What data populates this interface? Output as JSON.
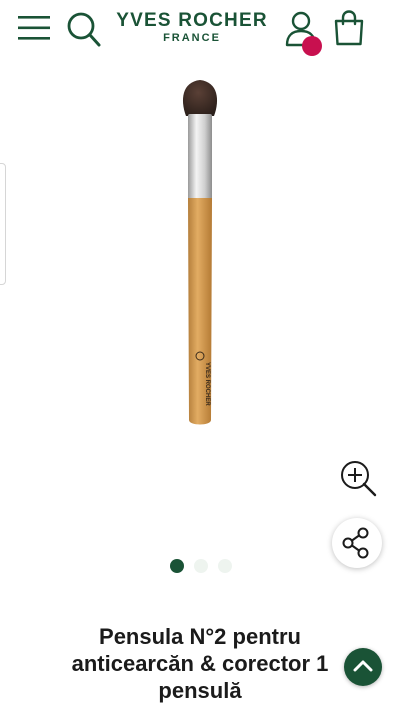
{
  "header": {
    "brand": "YVES ROCHER",
    "brand_sub": "FRANCE",
    "icons": {
      "menu": "hamburger-menu-icon",
      "search": "search-icon",
      "account": "user-account-icon",
      "bag": "shopping-bag-icon"
    },
    "colors": {
      "brand": "#1a5336",
      "badge": "#c8104f"
    }
  },
  "gallery": {
    "image": "makeup-brush-product-image",
    "brush_label": "YVES ROCHER",
    "zoom_icon": "zoom-in-icon",
    "share_icon": "share-icon",
    "slide_count": 3,
    "active_slide": 1
  },
  "product": {
    "title": "Pensula N°2 pentru anticearcăn & corector 1 pensulă"
  },
  "scroll_top_icon": "chevron-up-icon"
}
